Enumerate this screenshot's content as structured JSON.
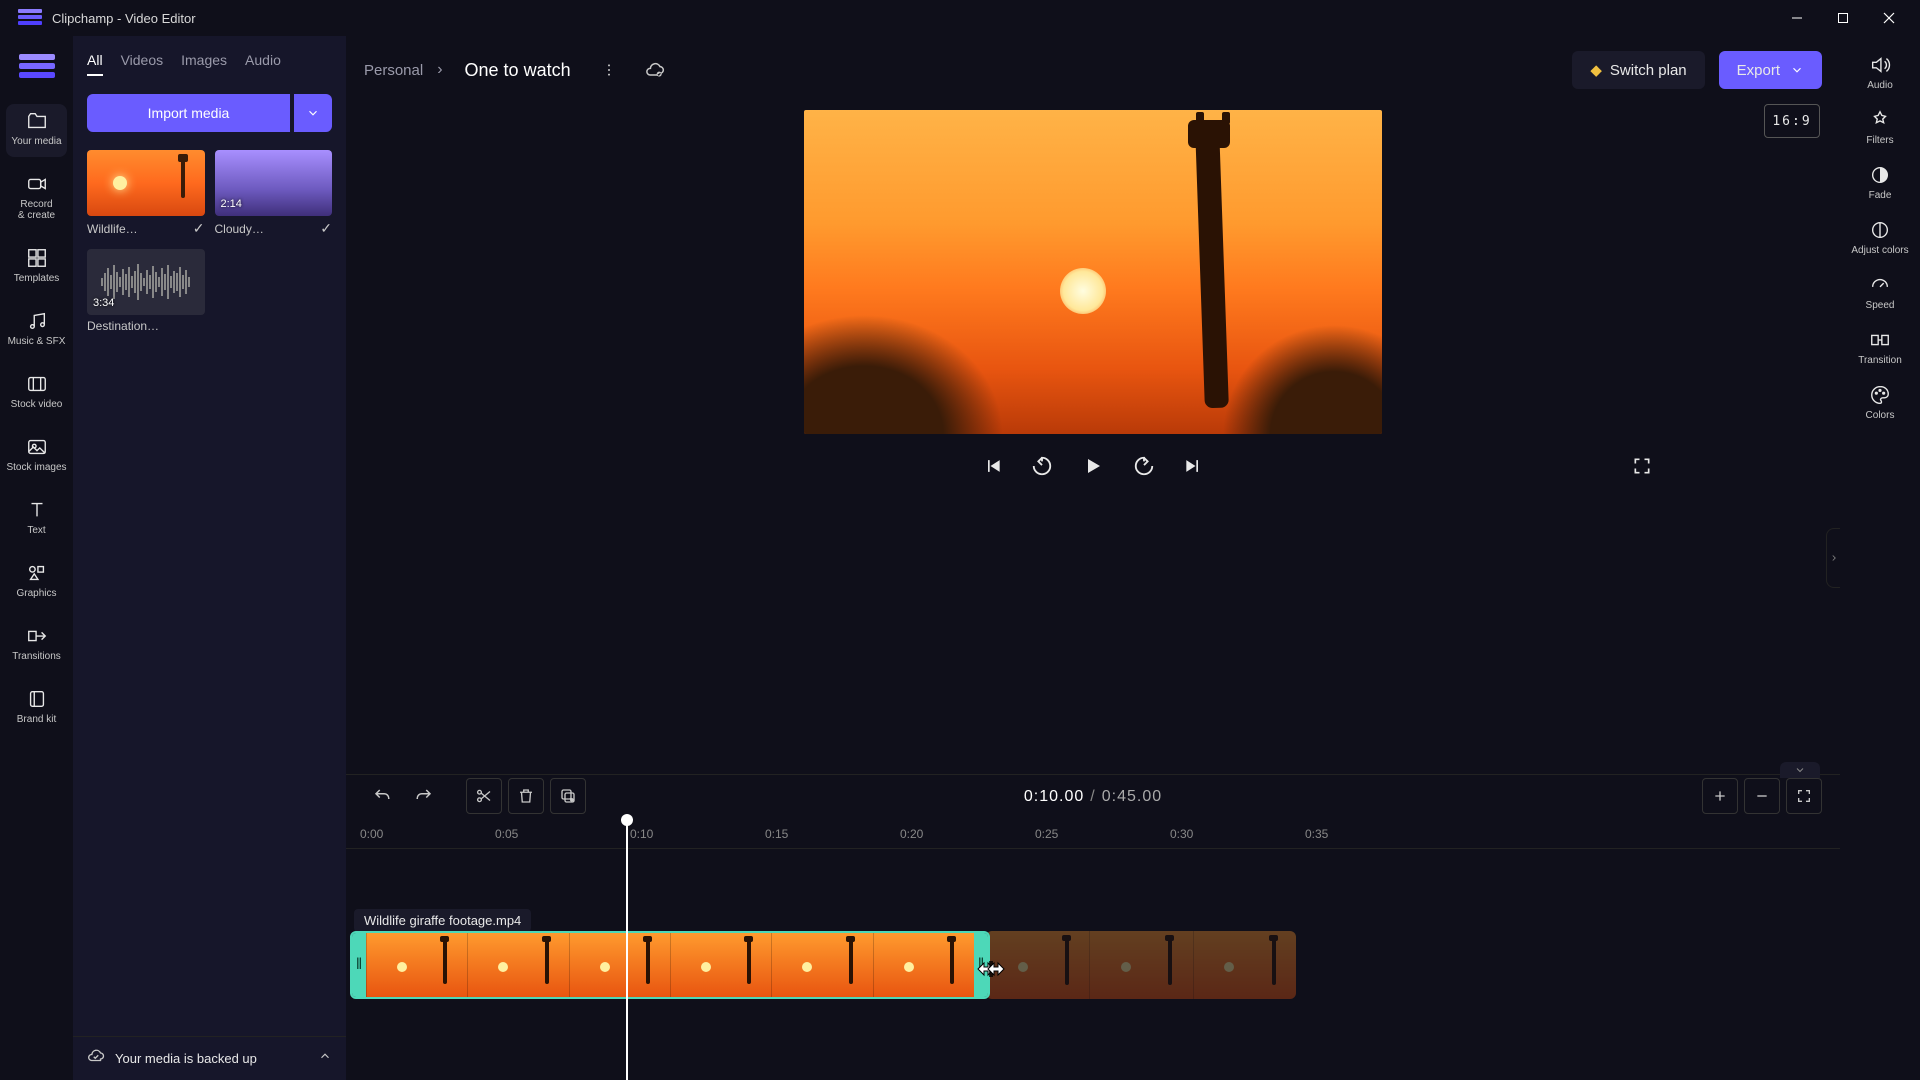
{
  "window": {
    "title": "Clipchamp - Video Editor"
  },
  "leftbar": {
    "items": [
      {
        "label": "Your media"
      },
      {
        "label": "Record\n& create"
      },
      {
        "label": "Templates"
      },
      {
        "label": "Music & SFX"
      },
      {
        "label": "Stock video"
      },
      {
        "label": "Stock images"
      },
      {
        "label": "Text"
      },
      {
        "label": "Graphics"
      },
      {
        "label": "Transitions"
      },
      {
        "label": "Brand kit"
      }
    ]
  },
  "media_tabs": [
    "All",
    "Videos",
    "Images",
    "Audio"
  ],
  "import_label": "Import media",
  "media_items": [
    {
      "name": "Wildlife…",
      "duration": "",
      "checked": true
    },
    {
      "name": "Cloudy…",
      "duration": "2:14",
      "checked": true
    },
    {
      "name": "Destination…",
      "duration": "3:34",
      "checked": false
    }
  ],
  "backup_text": "Your media is backed up",
  "breadcrumb": {
    "root": "Personal",
    "project": "One to watch"
  },
  "switch_plan_label": "Switch plan",
  "export_label": "Export",
  "aspect_ratio": "16:9",
  "playback_time": {
    "current": "0:10.00",
    "total": "0:45.00"
  },
  "ruler_ticks": [
    "0:00",
    "0:05",
    "0:10",
    "0:15",
    "0:20",
    "0:25",
    "0:30",
    "0:35"
  ],
  "clip": {
    "filename": "Wildlife giraffe footage.mp4"
  },
  "rightbar": {
    "items": [
      {
        "label": "Audio"
      },
      {
        "label": "Filters"
      },
      {
        "label": "Fade"
      },
      {
        "label": "Adjust colors"
      },
      {
        "label": "Speed"
      },
      {
        "label": "Transition"
      },
      {
        "label": "Colors"
      }
    ]
  }
}
